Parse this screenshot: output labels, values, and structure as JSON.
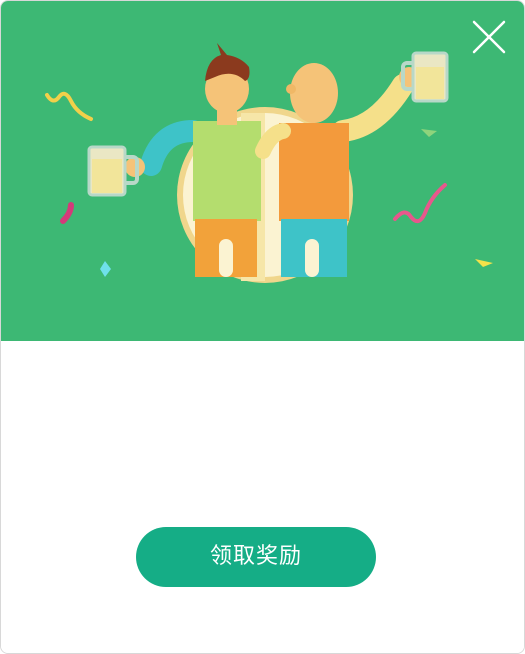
{
  "dialog": {
    "illustration": "two-men-toasting-beer-illustration",
    "close_icon": "close-icon",
    "claim_button_label": "领取奖励",
    "colors": {
      "banner_bg": "#3db874",
      "button_bg": "#15ad86",
      "button_text": "#ffffff"
    }
  }
}
